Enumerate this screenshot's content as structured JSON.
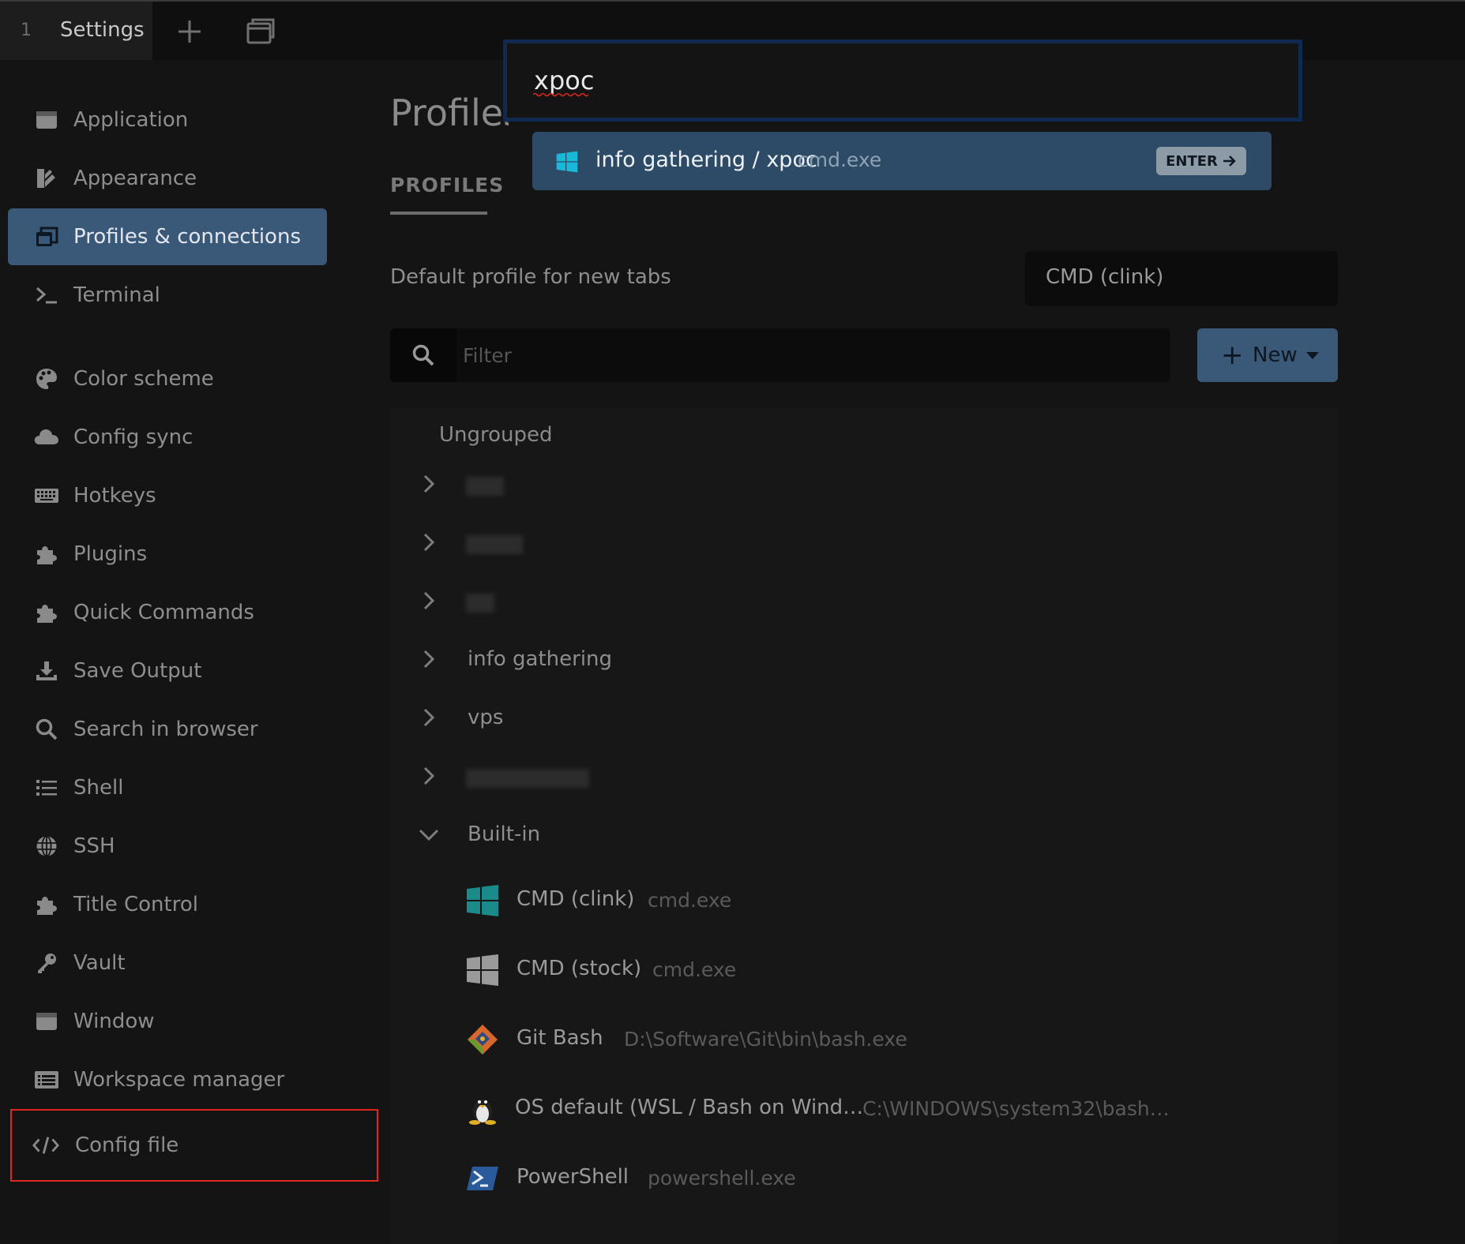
{
  "topbar": {
    "tab_number": "1",
    "tab_title": "Settings",
    "new_tab_icon": "plus-icon",
    "window_icon": "window-stack-icon"
  },
  "sidebar": {
    "items": [
      {
        "label": "Application",
        "icon": "window-icon"
      },
      {
        "label": "Appearance",
        "icon": "brush-icon"
      },
      {
        "label": "Profiles & connections",
        "icon": "profiles-icon",
        "active": true
      },
      {
        "label": "Terminal",
        "icon": "terminal-icon"
      },
      {
        "label": "Color scheme",
        "icon": "palette-icon"
      },
      {
        "label": "Config sync",
        "icon": "cloud-icon"
      },
      {
        "label": "Hotkeys",
        "icon": "keyboard-icon"
      },
      {
        "label": "Plugins",
        "icon": "puzzle-icon"
      },
      {
        "label": "Quick Commands",
        "icon": "puzzle-icon"
      },
      {
        "label": "Save Output",
        "icon": "download-icon"
      },
      {
        "label": "Search in browser",
        "icon": "search-icon"
      },
      {
        "label": "Shell",
        "icon": "list-icon"
      },
      {
        "label": "SSH",
        "icon": "globe-icon"
      },
      {
        "label": "Title Control",
        "icon": "puzzle-icon"
      },
      {
        "label": "Vault",
        "icon": "key-icon"
      },
      {
        "label": "Window",
        "icon": "window-icon"
      },
      {
        "label": "Workspace manager",
        "icon": "list-alt-icon"
      },
      {
        "label": "Config file",
        "icon": "code-icon",
        "highlighted": true
      }
    ]
  },
  "main": {
    "title": "Profiles",
    "tab_label": "PROFILES",
    "default_profile_label": "Default profile for new tabs",
    "default_profile_value": "CMD (clink)",
    "filter_placeholder": "Filter",
    "new_button_label": "New",
    "groups": {
      "ungrouped_label": "Ungrouped",
      "named": [
        "info gathering",
        "vps"
      ],
      "builtin_label": "Built-in"
    },
    "profiles": [
      {
        "name": "CMD (clink)",
        "path": "cmd.exe",
        "icon": "windows-icon",
        "color": "#1a8a8a"
      },
      {
        "name": "CMD (stock)",
        "path": "cmd.exe",
        "icon": "windows-icon",
        "color": "#9a9a9a"
      },
      {
        "name": "Git Bash",
        "path": "D:\\Software\\Git\\bin\\bash.exe",
        "icon": "git-icon",
        "color": "#d9662a"
      },
      {
        "name": "OS default (WSL / Bash on Wind…",
        "path": "C:\\WINDOWS\\system32\\bash…",
        "icon": "tux-icon",
        "color": "#e0b020"
      },
      {
        "name": "PowerShell",
        "path": "powershell.exe",
        "icon": "powershell-icon",
        "color": "#2a5a9a"
      }
    ]
  },
  "palette": {
    "query": "xpoc",
    "result_name": "info gathering / xpoc",
    "result_path": "cmd.exe",
    "enter_label": "ENTER",
    "result_icon": "windows-icon",
    "accent": "#18b8d8"
  }
}
